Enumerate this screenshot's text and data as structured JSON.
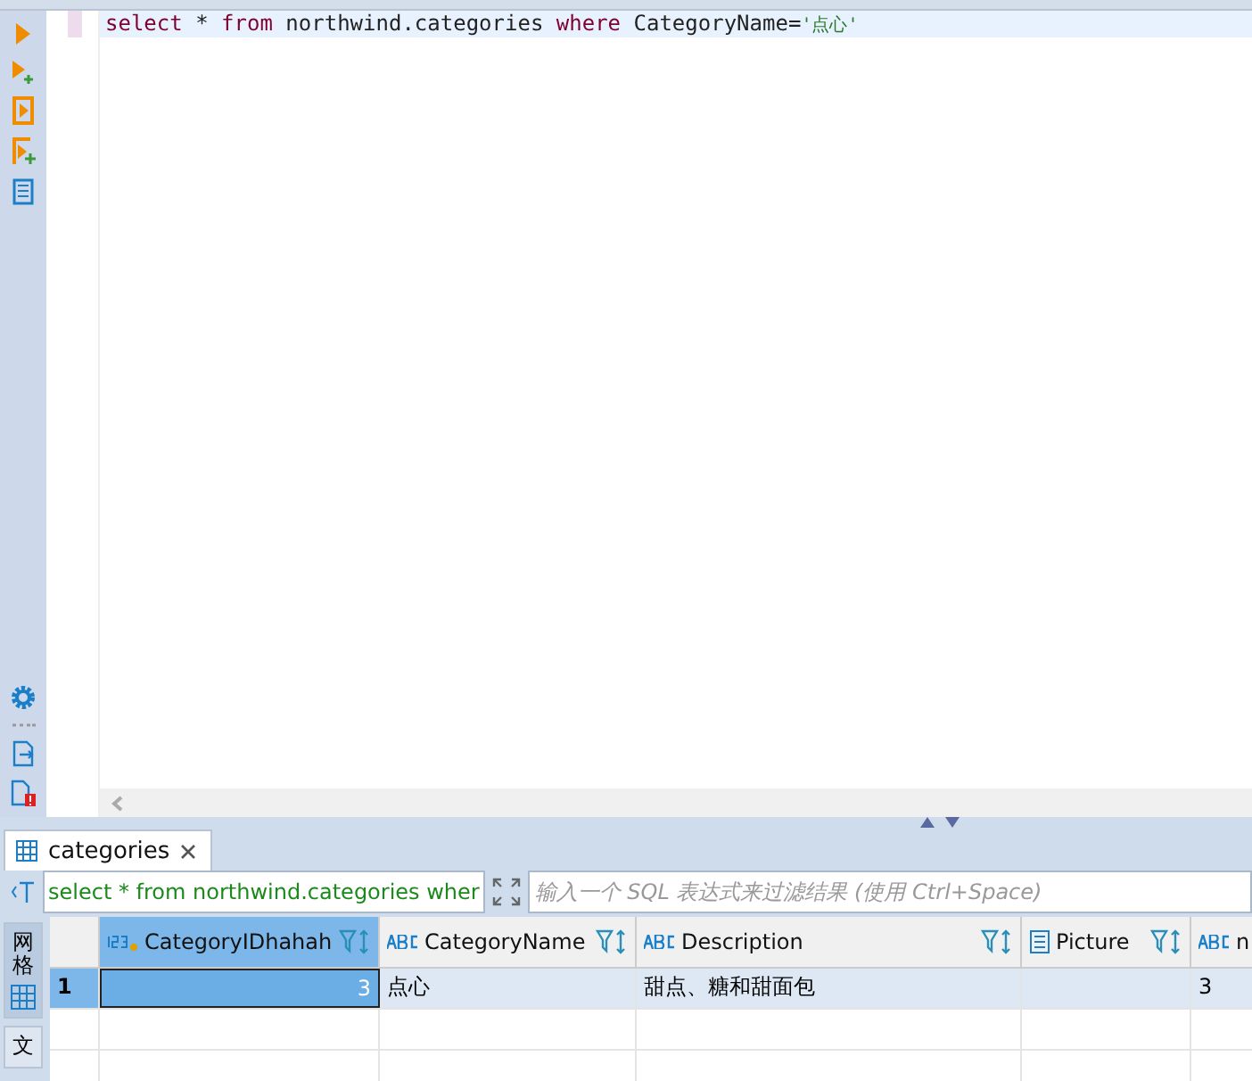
{
  "editor": {
    "query": [
      {
        "kind": "keyword",
        "text": "select"
      },
      {
        "kind": "plain",
        "text": " * "
      },
      {
        "kind": "keyword",
        "text": "from"
      },
      {
        "kind": "plain",
        "text": " northwind.categories "
      },
      {
        "kind": "keyword",
        "text": "where"
      },
      {
        "kind": "plain",
        "text": " CategoryName="
      },
      {
        "kind": "string",
        "text": "'点心'"
      }
    ]
  },
  "results_tab": {
    "label": "categories",
    "selected": true
  },
  "filter": {
    "query_text": "select * from northwind.categories wher",
    "placeholder": "输入一个 SQL 表达式来过滤结果 (使用 Ctrl+Space)"
  },
  "view_tabs": [
    {
      "label": "网格",
      "selected": true
    },
    {
      "label": "文",
      "selected": false
    }
  ],
  "table": {
    "columns": [
      {
        "name": "CategoryIDhahah",
        "kind": "number",
        "selected": true
      },
      {
        "name": "CategoryName",
        "kind": "text",
        "selected": false
      },
      {
        "name": "Description",
        "kind": "text",
        "selected": false
      },
      {
        "name": "Picture",
        "kind": "binary",
        "selected": false
      },
      {
        "name": "n",
        "kind": "text",
        "selected": false
      }
    ],
    "rows": [
      {
        "number": "1",
        "selected": true,
        "cells": [
          {
            "text": "3",
            "focused": true
          },
          {
            "text": "点心",
            "focused": false
          },
          {
            "text": "甜点、糖和甜面包",
            "focused": false
          },
          {
            "focused": false
          },
          {
            "text": "3",
            "focused": false
          }
        ]
      }
    ]
  }
}
